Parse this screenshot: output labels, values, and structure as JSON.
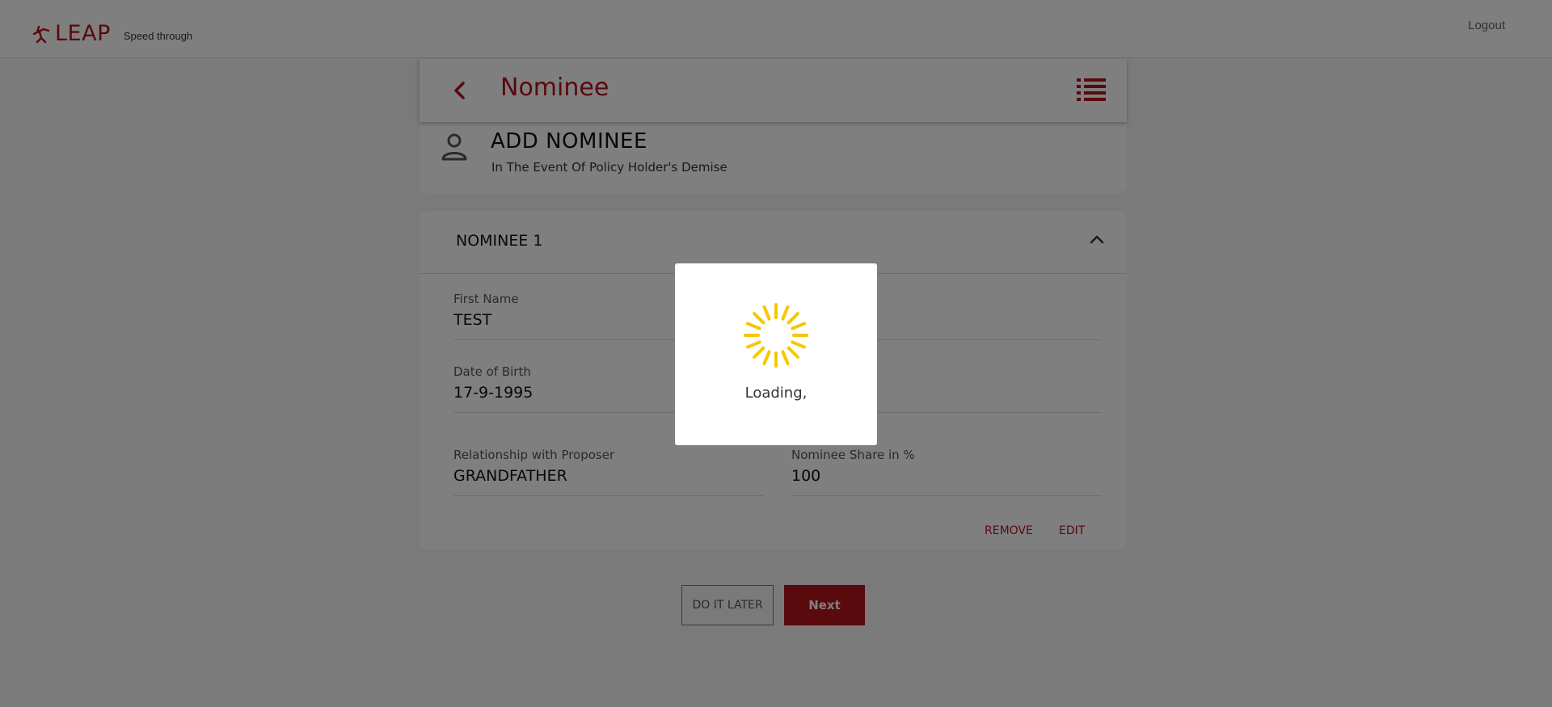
{
  "header": {
    "brand": "LEAP",
    "tagline": "Speed through",
    "logout": "Logout"
  },
  "page": {
    "title": "Nominee"
  },
  "add_nominee": {
    "title": "ADD NOMINEE",
    "subtitle": "In The Event Of Policy Holder's Demise"
  },
  "nominee": {
    "title": "NOMINEE 1",
    "fields": {
      "first_name": {
        "label": "First Name",
        "value": "TEST"
      },
      "dob": {
        "label": "Date of Birth",
        "value": "17-9-1995"
      },
      "relationship": {
        "label": "Relationship with Proposer",
        "value": "GRANDFATHER"
      },
      "share": {
        "label": "Nominee Share in %",
        "value": "100"
      }
    },
    "actions": {
      "remove": "REMOVE",
      "edit": "EDIT"
    }
  },
  "footer": {
    "later": "DO IT LATER",
    "next": "Next"
  },
  "loading": {
    "text": "Loading,"
  },
  "colors": {
    "brand_red": "#b5121b",
    "spinner": "#f5c800"
  }
}
